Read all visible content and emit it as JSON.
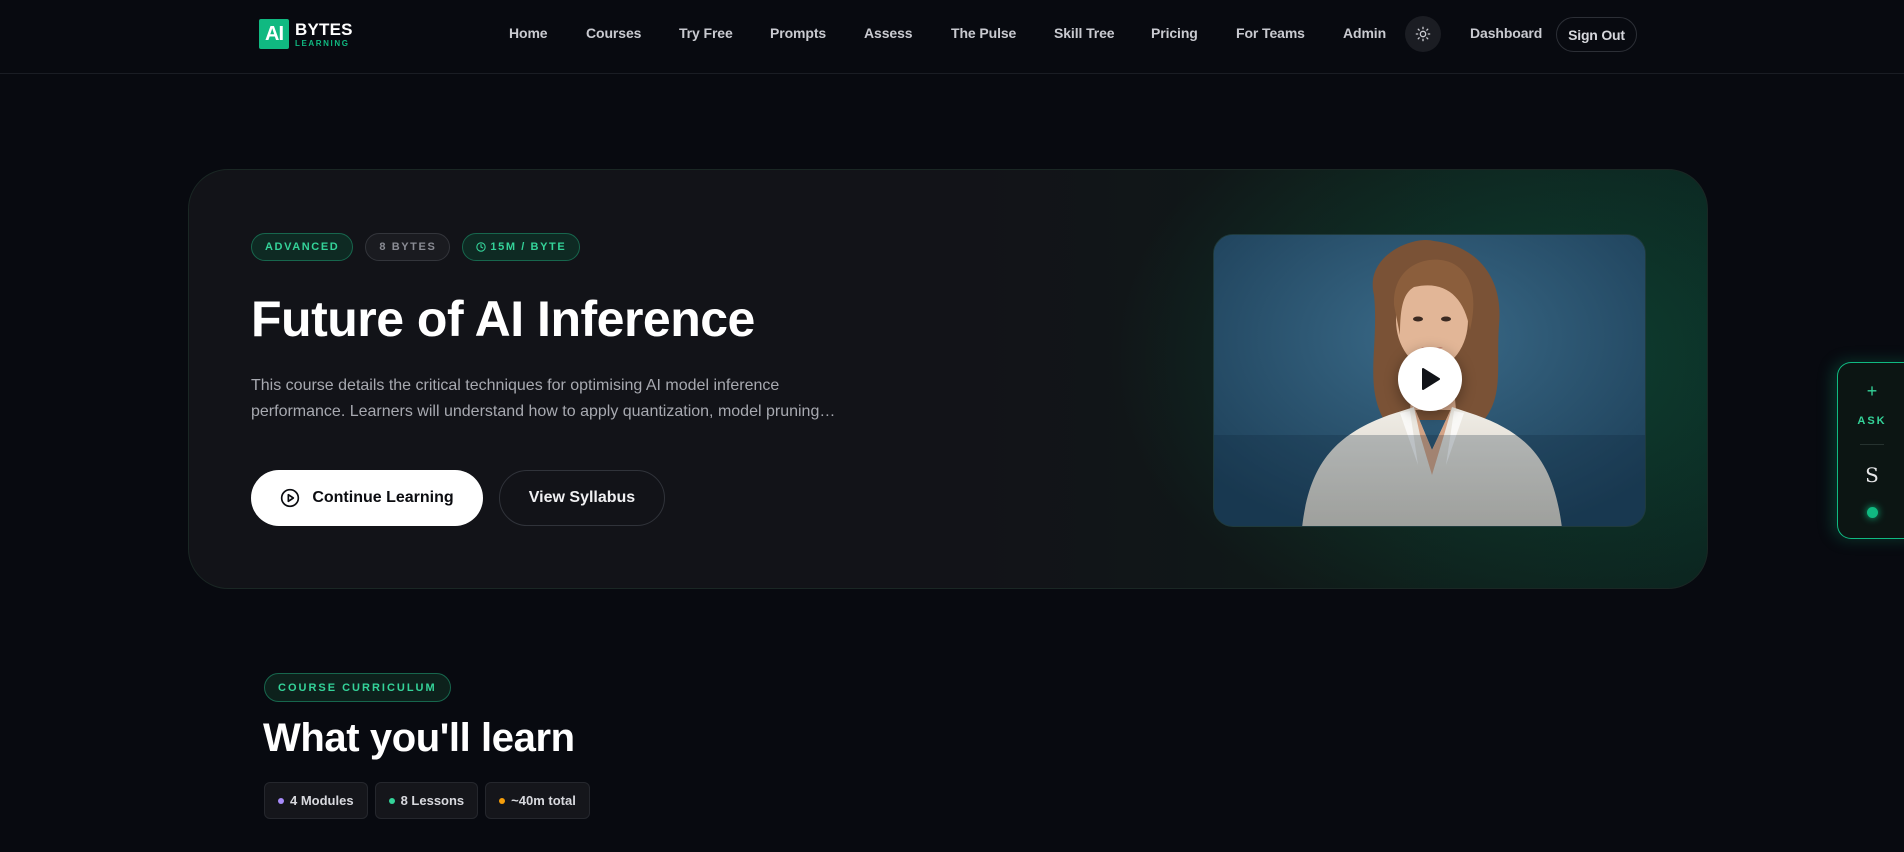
{
  "header": {
    "logo_mark": "AI",
    "logo_main": "BYTES",
    "logo_sub": "LEARNING",
    "nav": [
      {
        "label": "Home"
      },
      {
        "label": "Courses"
      },
      {
        "label": "Try Free"
      },
      {
        "label": "Prompts"
      },
      {
        "label": "Assess"
      },
      {
        "label": "The Pulse"
      },
      {
        "label": "Skill Tree"
      },
      {
        "label": "Pricing"
      },
      {
        "label": "For Teams"
      },
      {
        "label": "Admin"
      }
    ],
    "theme_icon": "sun-icon",
    "dashboard_label": "Dashboard",
    "signout_label": "Sign Out"
  },
  "hero": {
    "badges": {
      "level": "ADVANCED",
      "bytes": "8 BYTES",
      "time": "15M / BYTE"
    },
    "title": "Future of AI Inference",
    "description": "This course details the critical techniques for optimising AI model inference performance. Learners will understand how to apply quantization, model pruning and other optimisation methods.",
    "continue_label": "Continue Learning",
    "syllabus_label": "View Syllabus",
    "video": {
      "play_icon": "play-icon"
    }
  },
  "side_widget": {
    "ask_label": "ASK",
    "avatar_initial": "S"
  },
  "curriculum": {
    "badge": "COURSE CURRICULUM",
    "title": "What you'll learn",
    "stats": [
      {
        "label": "4 Modules",
        "color": "#a78bfa"
      },
      {
        "label": "8 Lessons",
        "color": "#34d399"
      },
      {
        "label": "~40m total",
        "color": "#f59e0b"
      }
    ]
  },
  "colors": {
    "accent": "#10b981",
    "background": "#080a10"
  }
}
